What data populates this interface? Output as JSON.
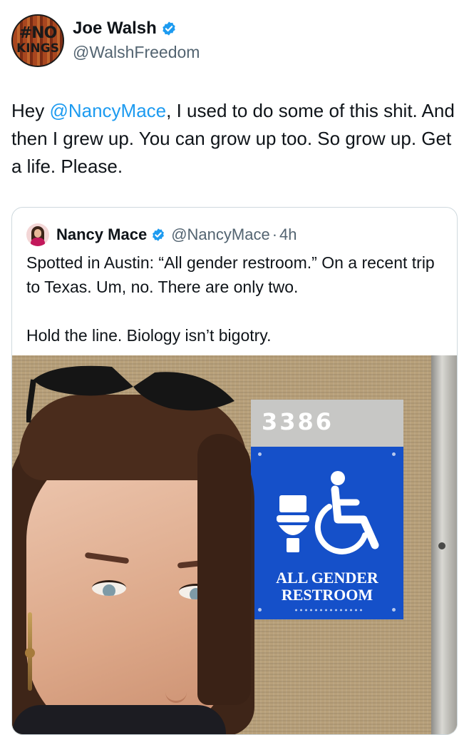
{
  "tweet": {
    "author_name": "Joe Walsh",
    "author_handle": "@WalshFreedom",
    "avatar_text_line1": "#NO",
    "avatar_text_line2": "KINGS",
    "text_before": "Hey ",
    "mention": "@NancyMace",
    "text_after": ", I used to do some of this shit. And then I grew up. You can grow up too. So grow up. Get a life. Please."
  },
  "quote": {
    "author_name": "Nancy Mace",
    "author_handle": "@NancyMace",
    "separator": "·",
    "timestamp": "4h",
    "text": "Spotted in Austin: “All gender restroom.” On a recent trip to Texas. Um, no. There are only two.\n\nHold the line. Biology isn’t bigotry.",
    "image": {
      "sign_number": "3386",
      "sign_label": "ALL GENDER\nRESTROOM"
    }
  },
  "colors": {
    "verified": "#1d9bf0",
    "mention": "#1d9bf0",
    "secondary_text": "#536471",
    "sign_blue": "#1550c9"
  },
  "icons": {
    "verified": "verified-badge-icon",
    "toilet": "toilet-icon",
    "wheelchair": "wheelchair-icon"
  }
}
